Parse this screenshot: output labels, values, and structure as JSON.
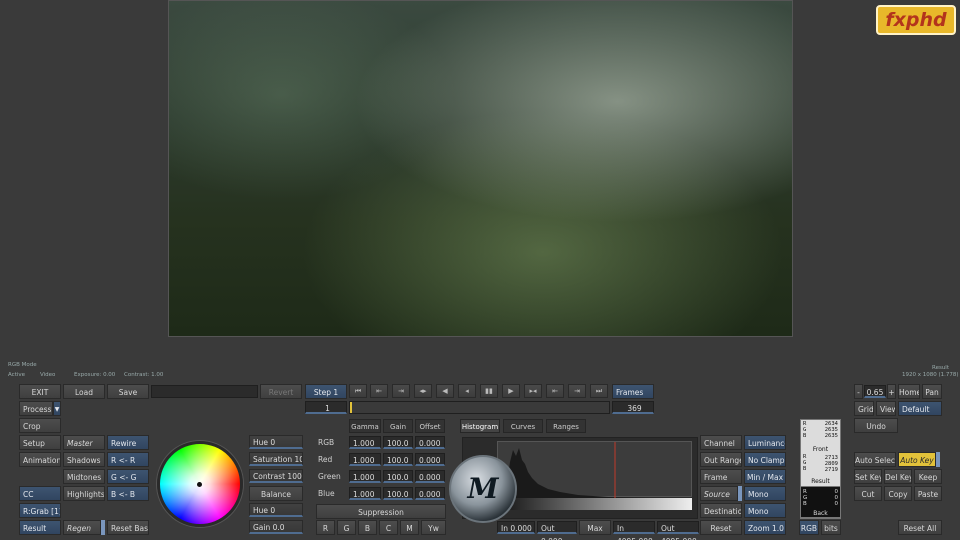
{
  "logo": "fxphd",
  "viewer": {
    "mode_label": "RGB Mode",
    "status_active": "Active",
    "status_video": "Video",
    "exposure": "Exposure: 0.00",
    "contrast": "Contrast: 1.00",
    "result_label": "Result",
    "resolution": "1920 x 1080 (1.778)"
  },
  "top_row": {
    "exit": "EXIT",
    "load": "Load",
    "save": "Save",
    "revert": "Revert",
    "step": "Step 1",
    "frames": "Frames",
    "frame_field": "1",
    "frames_field": "369"
  },
  "left_panel": {
    "process": "Process",
    "crop": "Crop",
    "setup": "Setup",
    "animation": "Animation",
    "cc": "CC",
    "rgrab": "R:Grab [1]",
    "result": "Result"
  },
  "tone_panel": {
    "master": "Master",
    "shadows": "Shadows",
    "midtones": "Midtones",
    "highlights": "Highlights",
    "regen": "Regen",
    "rewire": "Rewire",
    "r_r": "R <- R",
    "g_g": "G <- G",
    "b_b": "B <- B",
    "reset_basics": "Reset Basics"
  },
  "adjust_panel": {
    "hue_top": "Hue 0",
    "saturation": "Saturation 100",
    "contrast": "Contrast 100",
    "balance": "Balance",
    "hue_bottom": "Hue 0",
    "gain": "Gain 0.0"
  },
  "channel_grid": {
    "tabs": [
      "Gamma",
      "Gain",
      "Offset"
    ],
    "rows": [
      {
        "label": "RGB",
        "gamma": "1.000",
        "gain": "100.0",
        "offset": "0.000"
      },
      {
        "label": "Red",
        "gamma": "1.000",
        "gain": "100.0",
        "offset": "0.000"
      },
      {
        "label": "Green",
        "gamma": "1.000",
        "gain": "100.0",
        "offset": "0.000"
      },
      {
        "label": "Blue",
        "gamma": "1.000",
        "gain": "100.0",
        "offset": "0.000"
      }
    ],
    "suppression": "Suppression",
    "channel_buttons": [
      "R",
      "G",
      "B",
      "C",
      "M",
      "Yw"
    ]
  },
  "histogram": {
    "tabs": [
      "Histogram",
      "Curves",
      "Ranges"
    ],
    "in_field": "In 0.000",
    "out_field": "Out 0.000",
    "max": "Max",
    "in_max": "In 4095.000",
    "out_max": "Out 4095.000"
  },
  "view_options": {
    "channel": "Channel",
    "luminance": "Luminance",
    "out_range": "Out Range",
    "no_clamp": "No Clamp",
    "frame": "Frame",
    "min_max": "Min / Max",
    "source": "Source",
    "mono1": "Mono",
    "destination": "Destination",
    "mono2": "Mono",
    "reset": "Reset",
    "zoom": "Zoom 1.0"
  },
  "info_box": {
    "rgb_top": "RGB",
    "vals_top": [
      "2634",
      "2635",
      "2635"
    ],
    "front": "Front",
    "rgb_mid": "RGB",
    "vals_mid": [
      "2713",
      "2809",
      "2719"
    ],
    "result": "Result",
    "rgb_bottom": "RGB",
    "vals_bottom": [
      "0",
      "0",
      "0"
    ],
    "back": "Back",
    "rgb_btn": "RGB",
    "bits_btn": "bits"
  },
  "right_panel": {
    "minus": "-",
    "zoom_value": "0.65",
    "plus": "+",
    "home": "Home",
    "pan": "Pan",
    "grid": "Grid",
    "view": "View",
    "default": "Default",
    "undo": "Undo",
    "auto_select": "Auto Select",
    "auto_key": "Auto Key",
    "set_key": "Set Key",
    "del_key": "Del Key",
    "keep": "Keep",
    "cut": "Cut",
    "copy": "Copy",
    "paste": "Paste",
    "reset_all": "Reset All"
  }
}
